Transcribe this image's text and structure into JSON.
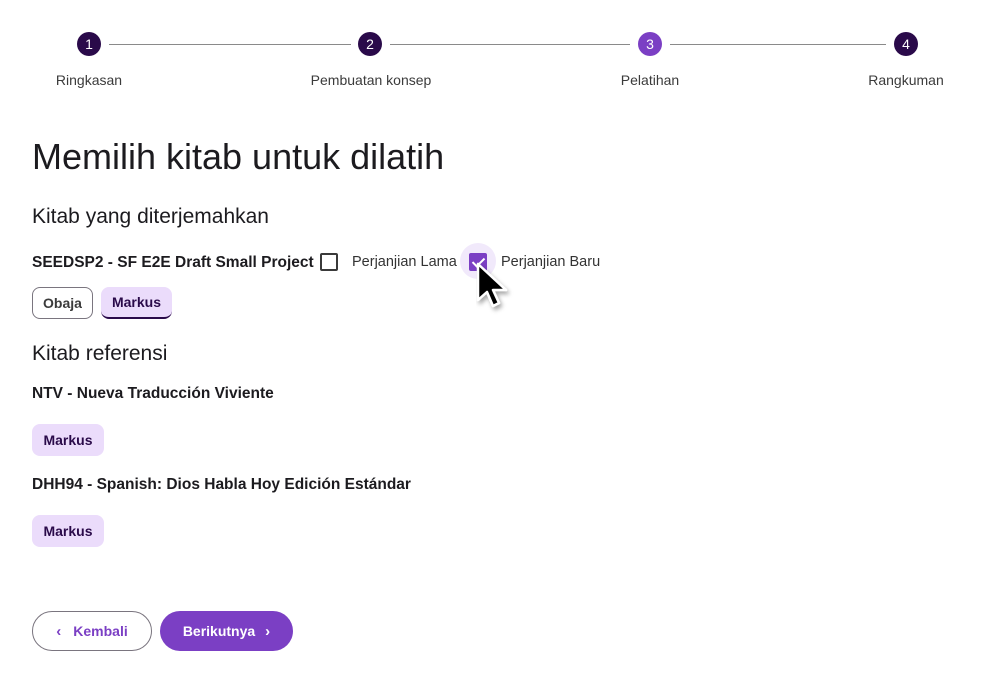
{
  "stepper": {
    "steps": [
      {
        "number": "1",
        "label": "Ringkasan"
      },
      {
        "number": "2",
        "label": "Pembuatan konsep"
      },
      {
        "number": "3",
        "label": "Pelatihan"
      },
      {
        "number": "4",
        "label": "Rangkuman"
      }
    ],
    "current_step": 3
  },
  "page": {
    "title": "Memilih kitab untuk dilatih"
  },
  "translated": {
    "heading": "Kitab yang diterjemahkan",
    "project": "SEEDSP2 - SF E2E Draft Small Project",
    "ot_label": "Perjanjian Lama",
    "ot_checked": false,
    "nt_label": "Perjanjian Baru",
    "nt_checked": true,
    "books": [
      {
        "label": "Obaja",
        "selected": false
      },
      {
        "label": "Markus",
        "selected": true
      }
    ]
  },
  "reference": {
    "heading": "Kitab referensi",
    "sources": [
      {
        "name": "NTV - Nueva Traducción Viviente",
        "books": [
          "Markus"
        ]
      },
      {
        "name": "DHH94 - Spanish: Dios Habla Hoy Edición Estándar",
        "books": [
          "Markus"
        ]
      }
    ]
  },
  "actions": {
    "back_label": "Kembali",
    "next_label": "Berikutnya"
  },
  "icons": {
    "back": "chevron-left-icon",
    "next": "chevron-right-icon",
    "cursor": "mouse-pointer-icon"
  },
  "colors": {
    "primary": "#7b3fc4",
    "step_done": "#2a0a4a",
    "chip_bg": "#ebdcfb"
  }
}
